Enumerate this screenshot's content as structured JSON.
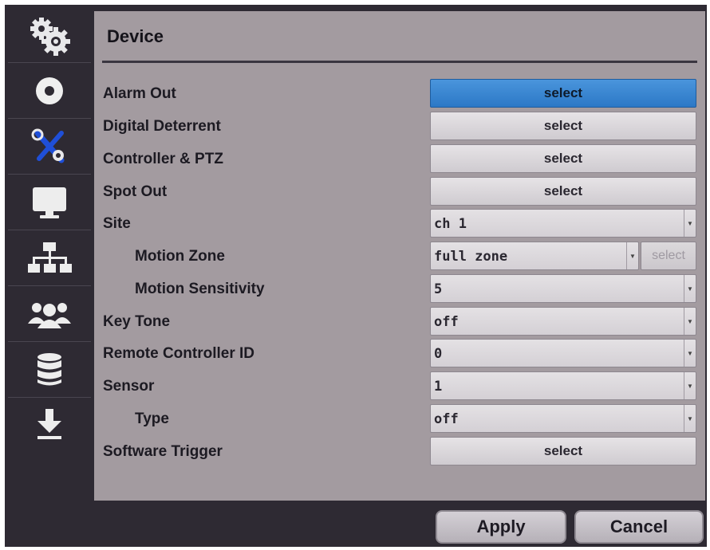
{
  "panel": {
    "title": "Device"
  },
  "sidebar": {
    "items": [
      {
        "icon": "settings-gears-icon"
      },
      {
        "icon": "disc-icon"
      },
      {
        "icon": "device-tools-icon"
      },
      {
        "icon": "monitor-icon"
      },
      {
        "icon": "network-icon"
      },
      {
        "icon": "users-icon"
      },
      {
        "icon": "database-icon"
      },
      {
        "icon": "download-icon"
      }
    ]
  },
  "rows": {
    "alarm_out": {
      "label": "Alarm Out",
      "button": "select"
    },
    "digital_deterrent": {
      "label": "Digital Deterrent",
      "button": "select"
    },
    "controller_ptz": {
      "label": "Controller & PTZ",
      "button": "select"
    },
    "spot_out": {
      "label": "Spot Out",
      "button": "select"
    },
    "site": {
      "label": "Site",
      "value": "ch 1"
    },
    "motion_zone": {
      "label": "Motion Zone",
      "value": "full zone",
      "button": "select"
    },
    "motion_sensitivity": {
      "label": "Motion Sensitivity",
      "value": "5"
    },
    "key_tone": {
      "label": "Key Tone",
      "value": "off"
    },
    "remote_controller_id": {
      "label": "Remote Controller ID",
      "value": "0"
    },
    "sensor": {
      "label": "Sensor",
      "value": "1"
    },
    "type": {
      "label": "Type",
      "value": "off"
    },
    "software_trigger": {
      "label": "Software Trigger",
      "button": "select"
    }
  },
  "footer": {
    "apply": "Apply",
    "cancel": "Cancel"
  },
  "colors": {
    "selected_button": "#2c78c6",
    "panel_bg": "#a39ba0",
    "frame_bg": "#2e2a33"
  }
}
